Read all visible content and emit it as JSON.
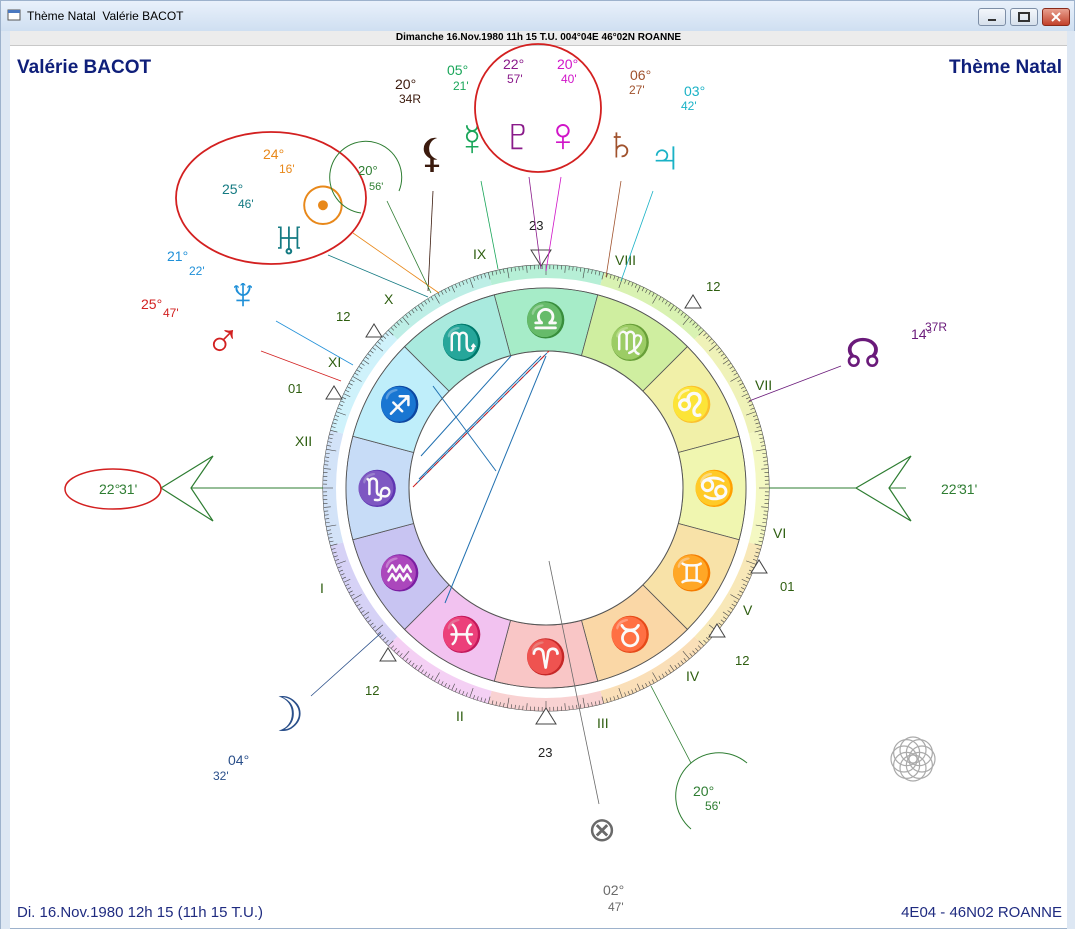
{
  "window": {
    "title": "Thème Natal  Valérie BACOT",
    "header": "Dimanche 16.Nov.1980 11h 15 T.U. 004°04E 46°02N  ROANNE"
  },
  "chart": {
    "name": "Valérie BACOT",
    "type_label": "Thème Natal",
    "footer_left": "Di. 16.Nov.1980 12h 15 (11h 15 T.U.)",
    "footer_right": "4E04 - 46N02  ROANNE",
    "asc": {
      "deg": "22°",
      "min": "31'"
    },
    "desc": {
      "deg": "22°",
      "min": "31'"
    },
    "mc_deg": "23",
    "ic_deg": "23",
    "signs": [
      {
        "name": "libra",
        "glyph": "♎",
        "color": "#1a33c7"
      },
      {
        "name": "virgo",
        "glyph": "♍",
        "color": "#8a4a10"
      },
      {
        "name": "leo",
        "glyph": "♌",
        "color": "#d22020"
      },
      {
        "name": "cancer",
        "glyph": "♋",
        "color": "#127a6e"
      },
      {
        "name": "gemini",
        "glyph": "♊",
        "color": "#1a33c7"
      },
      {
        "name": "taurus",
        "glyph": "♉",
        "color": "#8a4a10"
      },
      {
        "name": "aries",
        "glyph": "♈",
        "color": "#d22020"
      },
      {
        "name": "pisces",
        "glyph": "♓",
        "color": "#127a6e"
      },
      {
        "name": "aquarius",
        "glyph": "♒",
        "color": "#1a33c7"
      },
      {
        "name": "capricorn",
        "glyph": "♑",
        "color": "#8a4a10"
      },
      {
        "name": "sagittarius",
        "glyph": "♐",
        "color": "#d22020"
      },
      {
        "name": "scorpio",
        "glyph": "♏",
        "color": "#127a6e"
      }
    ],
    "houses": [
      "IX",
      "VIII",
      "VII",
      "VI",
      "V",
      "IV",
      "III",
      "II",
      "I",
      "XII",
      "XI",
      "X"
    ],
    "house_cusp_degrees": [
      "12",
      "01",
      "12",
      "12",
      "01",
      "12"
    ],
    "planets": [
      {
        "name": "moon",
        "glyph": "☽",
        "color": "#2a4f8a",
        "deg": "04°",
        "min": "32'"
      },
      {
        "name": "black-moon",
        "glyph": "⚸",
        "color": "#3b1a0d",
        "deg": "20°",
        "min": "34R"
      },
      {
        "name": "mercury",
        "glyph": "☿",
        "color": "#1aa65a",
        "deg": "05°",
        "min": "21'"
      },
      {
        "name": "pluto",
        "glyph": "♇",
        "color": "#8a1a8a",
        "deg": "22°",
        "min": "57'"
      },
      {
        "name": "venus",
        "glyph": "♀",
        "color": "#d015c8",
        "deg": "20°",
        "min": "40'"
      },
      {
        "name": "saturn",
        "glyph": "♄",
        "color": "#a0522d",
        "deg": "06°",
        "min": "27'"
      },
      {
        "name": "jupiter",
        "glyph": "♃",
        "color": "#1ab2c6",
        "deg": "03°",
        "min": "42'"
      },
      {
        "name": "sun",
        "glyph": "☉",
        "color": "#e8881a",
        "deg": "24°",
        "min": "16'"
      },
      {
        "name": "uranus",
        "glyph": "♅",
        "color": "#147a82",
        "deg": "25°",
        "min": "46'"
      },
      {
        "name": "neptune",
        "glyph": "♆",
        "color": "#2090d8",
        "deg": "21°",
        "min": "22'"
      },
      {
        "name": "mars",
        "glyph": "♂",
        "color": "#d22020",
        "deg": "25°",
        "min": "47'"
      },
      {
        "name": "node",
        "glyph": "☊",
        "color": "#6a1a7a",
        "deg": "14°",
        "min": "37R"
      },
      {
        "name": "part-of-fortune",
        "glyph": "⊗",
        "color": "#6a6a6a",
        "deg": "02°",
        "min": "47'"
      }
    ],
    "midpoint_top": {
      "deg": "20°",
      "min": "56'"
    },
    "midpoint_bottom": {
      "deg": "20°",
      "min": "56'"
    }
  }
}
